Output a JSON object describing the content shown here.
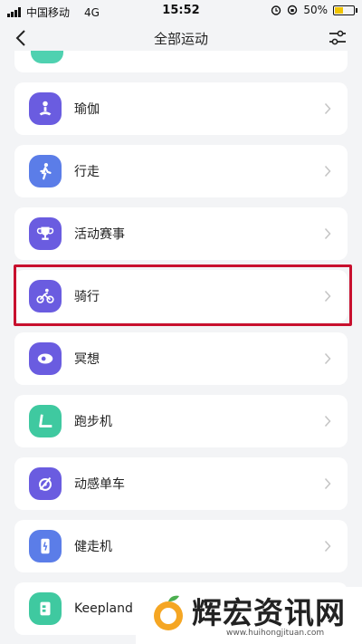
{
  "status_bar": {
    "carrier": "中国移动",
    "network": "4G",
    "time": "15:52",
    "battery_percent": "50%",
    "battery_level": 0.5
  },
  "nav": {
    "title": "全部运动",
    "back_icon": "chevron-left-icon",
    "filter_icon": "sliders-icon"
  },
  "activities": [
    {
      "label": "瑜伽",
      "icon": "yoga-icon",
      "color": "#6a5ce0"
    },
    {
      "label": "行走",
      "icon": "walk-icon",
      "color": "#5b7de8"
    },
    {
      "label": "活动赛事",
      "icon": "trophy-icon",
      "color": "#6a5ce0"
    },
    {
      "label": "骑行",
      "icon": "bike-icon",
      "color": "#6a5ce0"
    },
    {
      "label": "冥想",
      "icon": "meditation-icon",
      "color": "#6a5ce0"
    },
    {
      "label": "跑步机",
      "icon": "treadmill-icon",
      "color": "#3fc9a0"
    },
    {
      "label": "动感单车",
      "icon": "spin-bike-icon",
      "color": "#6a5ce0"
    },
    {
      "label": "健走机",
      "icon": "walking-machine-icon",
      "color": "#5b7de8"
    },
    {
      "label": "Keepland",
      "icon": "keepland-icon",
      "color": "#3fc9a0"
    }
  ],
  "highlighted_item": "骑行",
  "watermark": {
    "text": "辉宏资讯网",
    "url": "www.huihongjituan.com"
  }
}
